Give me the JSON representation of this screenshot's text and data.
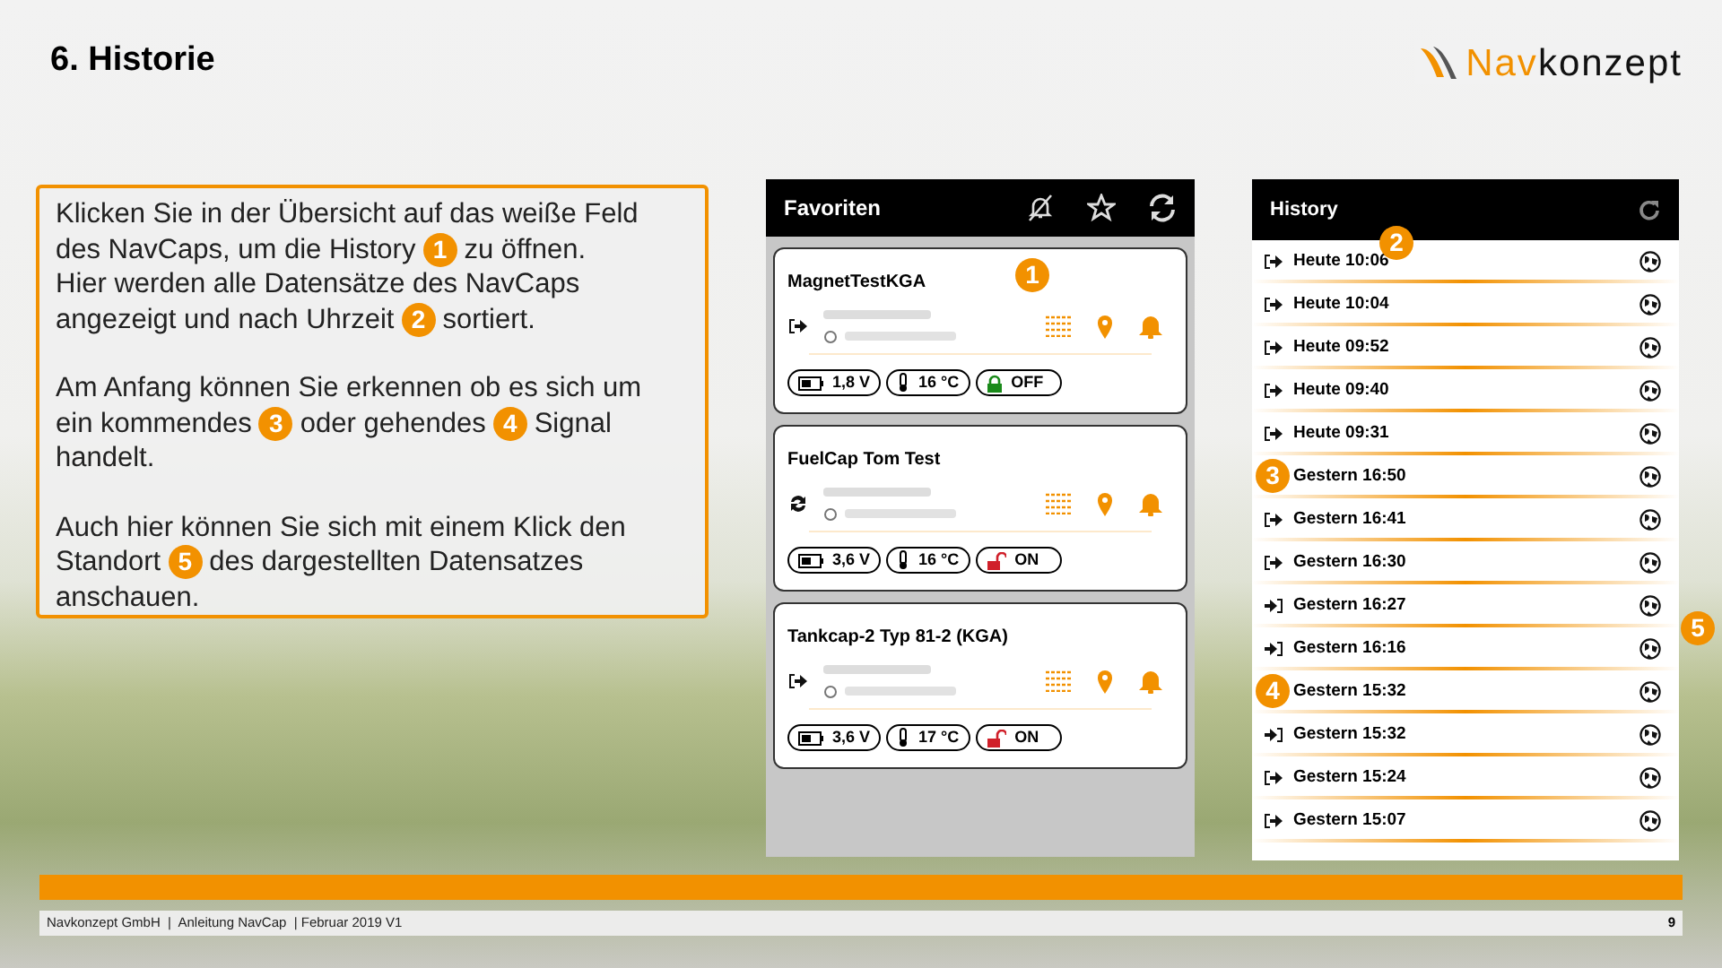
{
  "slide_title": "6. Historie",
  "logo": {
    "part_1": "Nav",
    "part_2": "konzept"
  },
  "intro": {
    "paragraphs": [
      [
        [
          {
            "kind": "text",
            "text": "Klicken Sie in der Übersicht auf das weiße Feld"
          }
        ],
        [
          {
            "kind": "text",
            "text": "des NavCaps, um die History"
          },
          {
            "kind": "badge",
            "text": "1"
          },
          {
            "kind": "text",
            "text": "zu öffnen."
          }
        ],
        [
          {
            "kind": "text",
            "text": "Hier werden alle Datensätze des NavCaps"
          }
        ],
        [
          {
            "kind": "text",
            "text": "angezeigt und nach Uhrzeit"
          },
          {
            "kind": "badge",
            "text": "2"
          },
          {
            "kind": "text",
            "text": "sortiert."
          }
        ]
      ],
      [
        [
          {
            "kind": "text",
            "text": "Am Anfang können Sie erkennen ob es sich um"
          }
        ],
        [
          {
            "kind": "text",
            "text": "ein kommendes"
          },
          {
            "kind": "badge",
            "text": "3"
          },
          {
            "kind": "text",
            "text": "oder gehendes"
          },
          {
            "kind": "badge",
            "text": "4"
          },
          {
            "kind": "text",
            "text": "Signal"
          }
        ],
        [
          {
            "kind": "text",
            "text": "handelt."
          }
        ]
      ],
      [
        [
          {
            "kind": "text",
            "text": "Auch hier können Sie sich mit einem Klick den"
          }
        ],
        [
          {
            "kind": "text",
            "text": "Standort"
          },
          {
            "kind": "badge",
            "text": "5"
          },
          {
            "kind": "text",
            "text": "des dargestellten Datensatzes"
          }
        ],
        [
          {
            "kind": "text",
            "text": "anschauen."
          }
        ]
      ]
    ]
  },
  "favorites": {
    "title": "Favoriten",
    "cards": [
      {
        "title": "MagnetTestKGA",
        "kind": "out",
        "battery": "1,8 V",
        "temperature": "16 °C",
        "locked": true,
        "lock_label": "OFF",
        "callout": "1"
      },
      {
        "title": "FuelCap Tom Test",
        "kind": "sync",
        "battery": "3,6 V",
        "temperature": "16 °C",
        "locked": false,
        "lock_label": "ON"
      },
      {
        "title": "Tankcap-2 Typ 81-2 (KGA)",
        "kind": "out",
        "battery": "3,6 V",
        "temperature": "17 °C",
        "locked": false,
        "lock_label": "ON"
      }
    ]
  },
  "history": {
    "title": "History",
    "rows": [
      {
        "time": "Heute 10:06",
        "kind": "out",
        "callout": {
          "label": "2",
          "kind": "trailing"
        }
      },
      {
        "time": "Heute 10:04",
        "kind": "out"
      },
      {
        "time": "Heute 09:52",
        "kind": "out"
      },
      {
        "time": "Heute 09:40",
        "kind": "out"
      },
      {
        "time": "Heute 09:31",
        "kind": "out"
      },
      {
        "time": "Gestern 16:50",
        "kind": "in",
        "callout": {
          "label": "3",
          "kind": "left"
        }
      },
      {
        "time": "Gestern 16:41",
        "kind": "out"
      },
      {
        "time": "Gestern 16:30",
        "kind": "out"
      },
      {
        "time": "Gestern 16:27",
        "kind": "in"
      },
      {
        "time": "Gestern 16:16",
        "kind": "in",
        "callout": {
          "label": "5",
          "kind": "right"
        }
      },
      {
        "time": "Gestern 15:32",
        "kind": "out",
        "callout": {
          "label": "4",
          "kind": "left"
        }
      },
      {
        "time": "Gestern 15:32",
        "kind": "in"
      },
      {
        "time": "Gestern 15:24",
        "kind": "out"
      },
      {
        "time": "Gestern 15:07",
        "kind": "out"
      }
    ]
  },
  "footer": {
    "text": "Navkonzept GmbH  |  Anleitung NavCap  | Februar 2019 V1",
    "page": "9"
  }
}
